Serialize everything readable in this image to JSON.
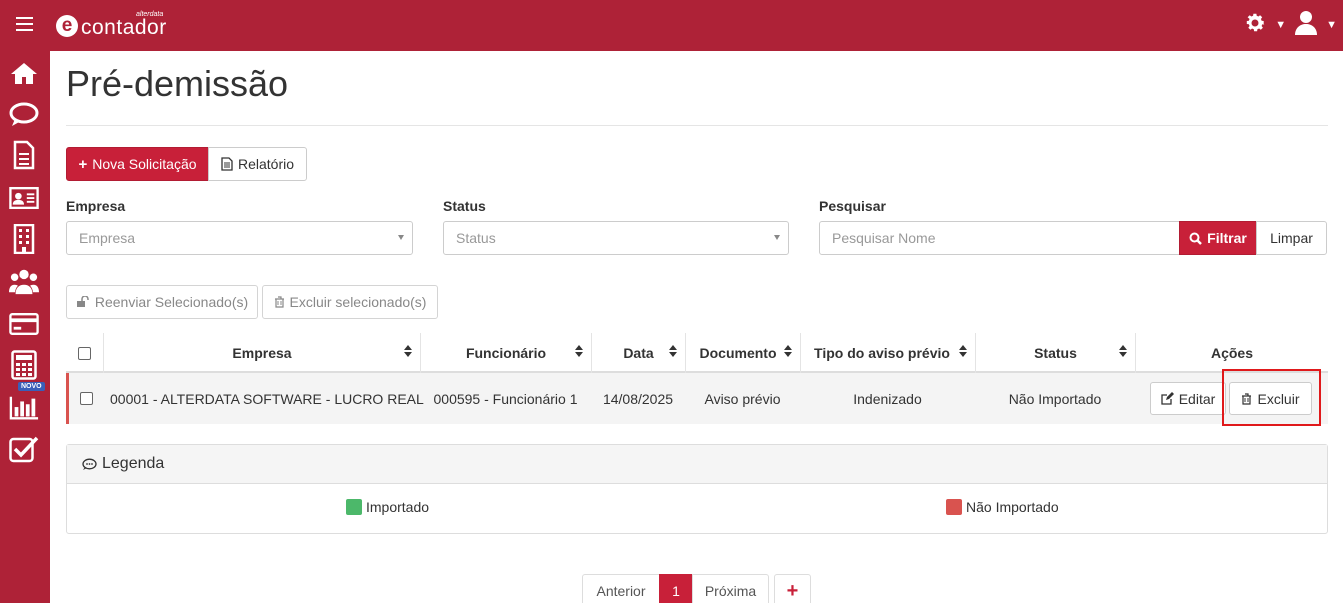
{
  "app": {
    "logo_text": "contador",
    "logo_brand": "alterdata",
    "logo_letter": "e"
  },
  "sidebar": {
    "badge": "NOVO",
    "items": [
      {
        "icon": "home-icon"
      },
      {
        "icon": "chat-icon"
      },
      {
        "icon": "document-icon"
      },
      {
        "icon": "id-card-icon"
      },
      {
        "icon": "building-icon"
      },
      {
        "icon": "users-icon"
      },
      {
        "icon": "credit-card-icon"
      },
      {
        "icon": "calculator-icon"
      },
      {
        "icon": "bar-chart-icon"
      },
      {
        "icon": "checkbox-icon"
      }
    ]
  },
  "page": {
    "title": "Pré-demissão"
  },
  "toolbar": {
    "new_label": "Nova Solicitação",
    "report_label": "Relatório",
    "resend_label": "Reenviar Selecionado(s)",
    "delete_selected_label": "Excluir selecionado(s)"
  },
  "filters": {
    "empresa_label": "Empresa",
    "empresa_placeholder": "Empresa",
    "status_label": "Status",
    "status_placeholder": "Status",
    "search_label": "Pesquisar",
    "search_placeholder": "Pesquisar Nome",
    "filter_button": "Filtrar",
    "clear_button": "Limpar"
  },
  "table": {
    "columns": [
      "Empresa",
      "Funcionário",
      "Data",
      "Documento",
      "Tipo do aviso prévio",
      "Status",
      "Ações"
    ],
    "rows": [
      {
        "empresa": "00001 - ALTERDATA SOFTWARE - LUCRO REAL",
        "funcionario": "000595 - Funcionário 1",
        "data": "14/08/2025",
        "documento": "Aviso prévio",
        "tipo": "Indenizado",
        "status": "Não Importado",
        "edit_label": "Editar",
        "delete_label": "Excluir"
      }
    ]
  },
  "legend": {
    "title": "Legenda",
    "items": [
      {
        "label": "Importado",
        "color": "#4cb86a"
      },
      {
        "label": "Não Importado",
        "color": "#d9534f"
      }
    ]
  },
  "pagination": {
    "prev": "Anterior",
    "current": "1",
    "next": "Próxima",
    "add": "+"
  },
  "colors": {
    "brand": "#ae2237",
    "primary_button": "#c82039",
    "highlight": "#e0191b"
  }
}
